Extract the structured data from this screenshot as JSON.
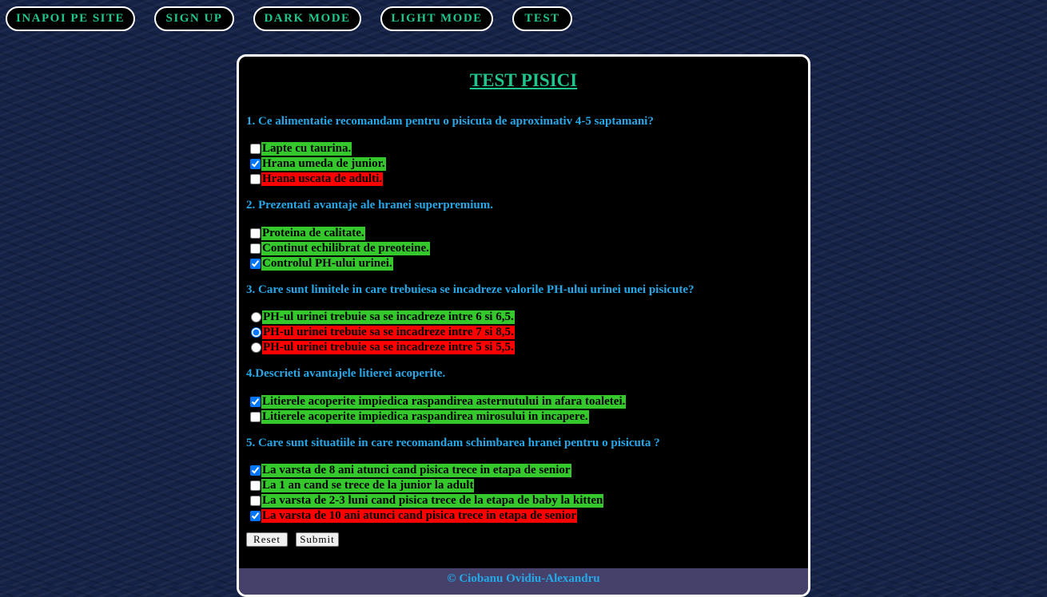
{
  "nav": {
    "back_label": "INAPOI PE SITE",
    "signup_label": "SIGN UP",
    "dark_label": "DARK MODE",
    "light_label": "LIGHT MODE",
    "test_label": "TEST"
  },
  "colors": {
    "accent": "#1fc48f",
    "question": "#26a8e8",
    "correct_bg": "#35c82d",
    "wrong_bg": "#ff0000",
    "footer_bg": "#45416a"
  },
  "page": {
    "title": "TEST PISICI"
  },
  "questions": [
    {
      "text": "1. Ce alimentatie recomandam pentru o pisicuta de aproximativ 4-5 saptamani?",
      "type": "checkbox",
      "options": [
        {
          "label": "Lapte cu taurina.",
          "checked": false,
          "correct": true
        },
        {
          "label": "Hrana umeda de junior.",
          "checked": true,
          "correct": true
        },
        {
          "label": "Hrana uscata de adulti.",
          "checked": false,
          "correct": false
        }
      ]
    },
    {
      "text": "2. Prezentati avantaje ale hranei superpremium.",
      "type": "checkbox",
      "options": [
        {
          "label": "Proteina de calitate.",
          "checked": false,
          "correct": true
        },
        {
          "label": "Continut echilibrat de preoteine.",
          "checked": false,
          "correct": true
        },
        {
          "label": "Controlul PH-ului urinei.",
          "checked": true,
          "correct": true
        }
      ]
    },
    {
      "text": "3. Care sunt limitele in care trebuiesa se incadreze valorile PH-ului urinei unei pisicute?",
      "type": "radio",
      "options": [
        {
          "label": "PH-ul urinei trebuie sa se incadreze intre 6 si 6,5.",
          "checked": false,
          "correct": true
        },
        {
          "label": "PH-ul urinei trebuie sa se incadreze intre 7 si 8,5.",
          "checked": true,
          "correct": false
        },
        {
          "label": "PH-ul urinei trebuie sa se incadreze intre 5 si 5,5.",
          "checked": false,
          "correct": false
        }
      ]
    },
    {
      "text": "4.Descrieti avantajele litierei acoperite.",
      "type": "checkbox",
      "options": [
        {
          "label": "Litierele acoperite impiedica raspandirea asternutului in afara toaletei.",
          "checked": true,
          "correct": true
        },
        {
          "label": "Litierele acoperite impiedica raspandirea mirosului in incapere.",
          "checked": false,
          "correct": true
        }
      ]
    },
    {
      "text": "5. Care sunt situatiile in care recomandam schimbarea hranei pentru o pisicuta ?",
      "type": "checkbox",
      "options": [
        {
          "label": "La varsta de 8 ani atunci cand pisica trece in etapa de senior",
          "checked": true,
          "correct": true
        },
        {
          "label": "La 1 an cand se trece de la junior la adult",
          "checked": false,
          "correct": true
        },
        {
          "label": "La varsta de 2-3 luni cand pisica trece de la etapa de baby la kitten",
          "checked": false,
          "correct": true
        },
        {
          "label": "La varsta de 10 ani atunci cand pisica trece in etapa de senior",
          "checked": true,
          "correct": false
        }
      ]
    }
  ],
  "form": {
    "reset_label": "Reset",
    "submit_label": "Submit"
  },
  "footer": {
    "text": "© Ciobanu Ovidiu-Alexandru"
  }
}
